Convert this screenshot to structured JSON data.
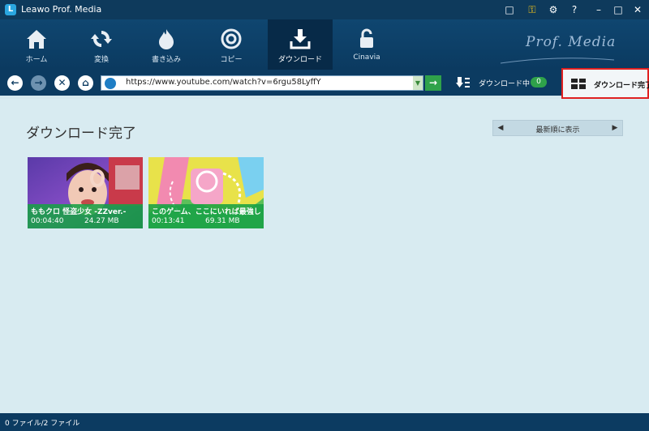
{
  "window": {
    "title": "Leawo Prof. Media"
  },
  "title_controls": [
    "chat-icon",
    "key-icon",
    "gear-icon",
    "help-icon",
    "minimize-icon",
    "maximize-icon",
    "close-icon"
  ],
  "nav": {
    "items": [
      {
        "label": "ホーム",
        "icon": "home-icon"
      },
      {
        "label": "変換",
        "icon": "convert-icon"
      },
      {
        "label": "書き込み",
        "icon": "burn-icon"
      },
      {
        "label": "コピー",
        "icon": "copy-icon"
      },
      {
        "label": "ダウンロード",
        "icon": "download-icon",
        "active": true
      },
      {
        "label": "Cinavia",
        "icon": "unlock-icon"
      }
    ],
    "brand": "Prof. Media"
  },
  "address": {
    "url": "https://www.youtube.com/watch?v=6rgu58LyffY",
    "downloading_label": "ダウンロード中",
    "downloading_count": "0",
    "completed_label": "ダウンロード完了"
  },
  "main": {
    "title": "ダウンロード完了",
    "sort_label": "最新順に表示",
    "videos": [
      {
        "title": "ももクロ 怪盗少女 -ZZver.-",
        "duration": "00:04:40",
        "size": "24.27 MB"
      },
      {
        "title": "このゲーム、ここにいれば最強し…",
        "duration": "00:13:41",
        "size": "69.31 MB"
      }
    ]
  },
  "status": {
    "text": "0 ファイル/2 ファイル"
  },
  "colors": {
    "accent_green": "#2fa24a",
    "highlight_red": "#e02020",
    "header_blue": "#0c3b61"
  }
}
